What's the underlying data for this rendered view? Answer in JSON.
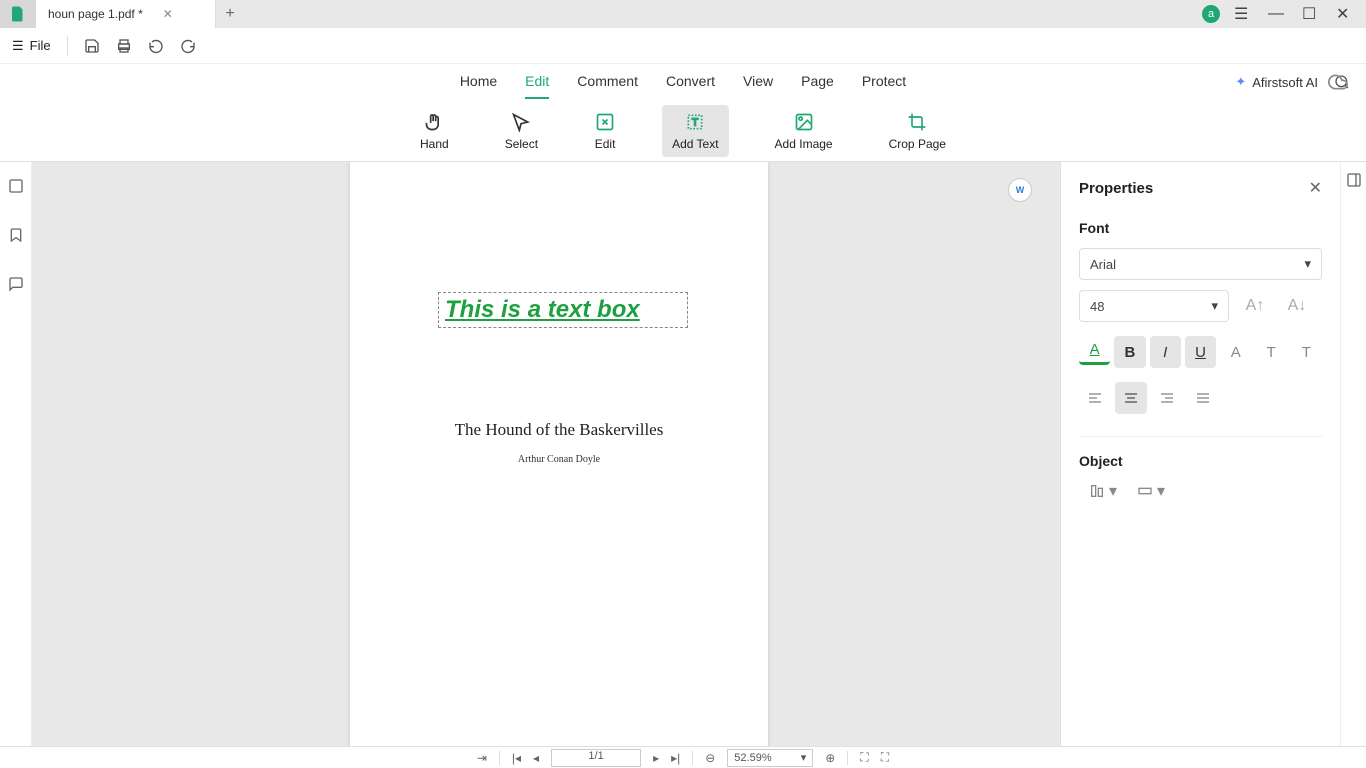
{
  "titlebar": {
    "tab_title": "houn page 1.pdf *",
    "user_initial": "a"
  },
  "file_menu": {
    "file_label": "File"
  },
  "main_menu": {
    "home": "Home",
    "edit": "Edit",
    "comment": "Comment",
    "convert": "Convert",
    "view": "View",
    "page": "Page",
    "protect": "Protect",
    "ai": "Afirstsoft AI"
  },
  "ribbon": {
    "hand": "Hand",
    "select": "Select",
    "edit": "Edit",
    "add_text": "Add Text",
    "add_image": "Add Image",
    "crop_page": "Crop Page"
  },
  "document": {
    "textbox_content": "This is a text box",
    "title": "The Hound of the Baskervilles",
    "author": "Arthur Conan Doyle"
  },
  "properties": {
    "panel_title": "Properties",
    "font_section": "Font",
    "font_family": "Arial",
    "font_size": "48",
    "object_section": "Object"
  },
  "statusbar": {
    "page_indicator": "1/1",
    "zoom_level": "52.59%"
  }
}
